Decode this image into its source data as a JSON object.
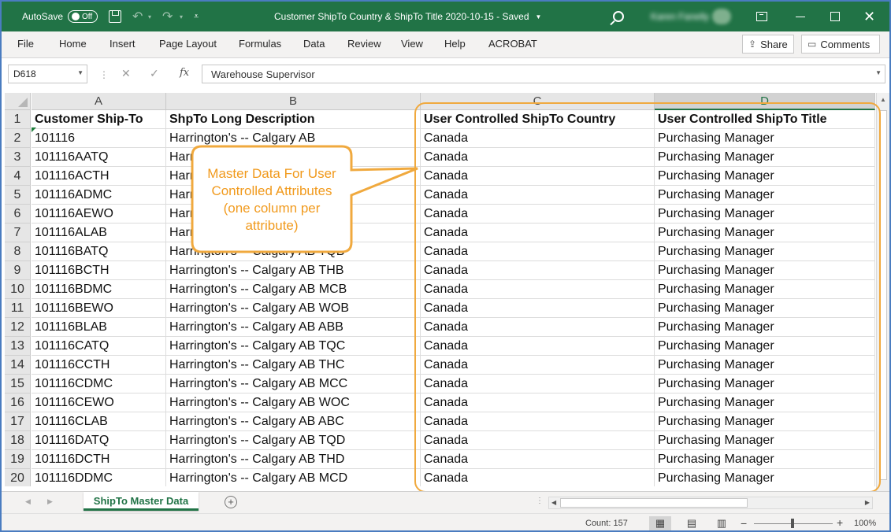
{
  "titlebar": {
    "autosave_label": "AutoSave",
    "autosave_state": "Off",
    "doc_title": "Customer ShipTo Country & ShipTo Title 2020-10-15  -  Saved",
    "user_name": "Karen Fanelly",
    "user_initials": "KF"
  },
  "ribbon": {
    "tabs": [
      "File",
      "Home",
      "Insert",
      "Page Layout",
      "Formulas",
      "Data",
      "Review",
      "View",
      "Help",
      "ACROBAT"
    ],
    "share_label": "Share",
    "comments_label": "Comments"
  },
  "formula_bar": {
    "name_box": "D618",
    "fx_label": "fx",
    "cancel_symbol": "✕",
    "enter_symbol": "✓",
    "content": "Warehouse Supervisor"
  },
  "sheet": {
    "columns": [
      "A",
      "B",
      "C",
      "D"
    ],
    "selected_column": "D",
    "header_row": [
      "Customer Ship-To",
      "ShpTo Long Description",
      "User Controlled ShipTo Country",
      "User Controlled ShipTo Title"
    ],
    "rows": [
      [
        "101116",
        "Harrington's -- Calgary AB",
        "Canada",
        "Purchasing Manager"
      ],
      [
        "101116AATQ",
        "Harrington's -- Calgary AB TQA",
        "Canada",
        "Purchasing Manager"
      ],
      [
        "101116ACTH",
        "Harrington's -- Calgary AB THA",
        "Canada",
        "Purchasing Manager"
      ],
      [
        "101116ADMC",
        "Harrington's -- Calgary AB MCA",
        "Canada",
        "Purchasing Manager"
      ],
      [
        "101116AEWO",
        "Harrington's -- Calgary AB WOA",
        "Canada",
        "Purchasing Manager"
      ],
      [
        "101116ALAB",
        "Harrington's -- Calgary AB ABA",
        "Canada",
        "Purchasing Manager"
      ],
      [
        "101116BATQ",
        "Harrington's -- Calgary AB TQB",
        "Canada",
        "Purchasing Manager"
      ],
      [
        "101116BCTH",
        "Harrington's -- Calgary AB THB",
        "Canada",
        "Purchasing Manager"
      ],
      [
        "101116BDMC",
        "Harrington's -- Calgary AB MCB",
        "Canada",
        "Purchasing Manager"
      ],
      [
        "101116BEWO",
        "Harrington's -- Calgary AB WOB",
        "Canada",
        "Purchasing Manager"
      ],
      [
        "101116BLAB",
        "Harrington's -- Calgary AB ABB",
        "Canada",
        "Purchasing Manager"
      ],
      [
        "101116CATQ",
        "Harrington's -- Calgary AB TQC",
        "Canada",
        "Purchasing Manager"
      ],
      [
        "101116CCTH",
        "Harrington's -- Calgary AB THC",
        "Canada",
        "Purchasing Manager"
      ],
      [
        "101116CDMC",
        "Harrington's -- Calgary AB MCC",
        "Canada",
        "Purchasing Manager"
      ],
      [
        "101116CEWO",
        "Harrington's -- Calgary AB WOC",
        "Canada",
        "Purchasing Manager"
      ],
      [
        "101116CLAB",
        "Harrington's -- Calgary AB ABC",
        "Canada",
        "Purchasing Manager"
      ],
      [
        "101116DATQ",
        "Harrington's -- Calgary AB TQD",
        "Canada",
        "Purchasing Manager"
      ],
      [
        "101116DCTH",
        "Harrington's -- Calgary AB THD",
        "Canada",
        "Purchasing Manager"
      ],
      [
        "101116DDMC",
        "Harrington's -- Calgary AB MCD",
        "Canada",
        "Purchasing Manager"
      ]
    ],
    "row_numbers": [
      1,
      2,
      3,
      4,
      5,
      6,
      7,
      8,
      9,
      10,
      11,
      12,
      13,
      14,
      15,
      16,
      17,
      18,
      19,
      20
    ]
  },
  "callout": {
    "text": "Master Data For User Controlled Attributes (one column per attribute)",
    "color": "#f0a93e"
  },
  "sheet_tabs": {
    "active": "ShipTo Master Data",
    "add_symbol": "+"
  },
  "statusbar": {
    "count": "Count: 157",
    "zoom": "100%",
    "zoom_minus": "−",
    "zoom_plus": "+"
  },
  "colors": {
    "excel_green": "#217346",
    "callout_orange": "#f0a93e",
    "window_border": "#4a7cc0"
  }
}
